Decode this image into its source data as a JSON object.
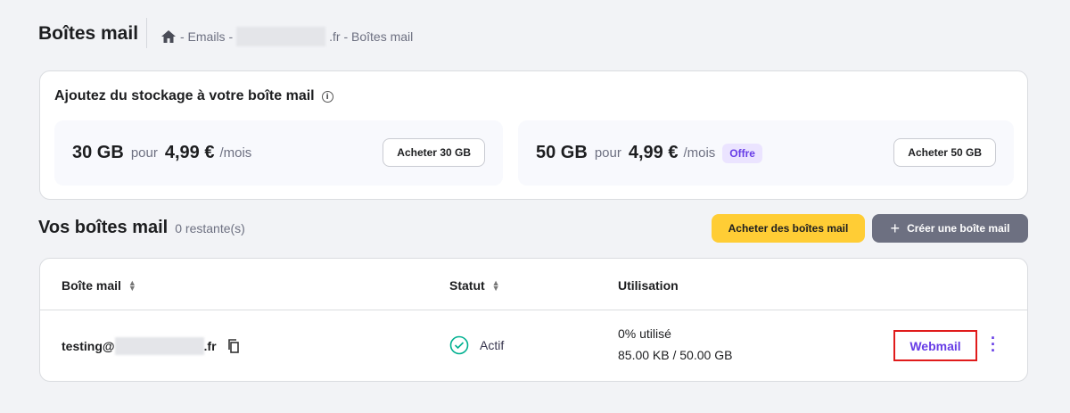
{
  "header": {
    "title": "Boîtes mail",
    "breadcrumb": {
      "emails": "- Emails -",
      "domain_suffix": ".fr - Boîtes mail"
    }
  },
  "storage": {
    "title": "Ajoutez du stockage à votre boîte mail",
    "offers": [
      {
        "size": "30 GB",
        "pour": "pour",
        "price": "4,99 €",
        "period": "/mois",
        "button": "Acheter 30 GB"
      },
      {
        "size": "50 GB",
        "pour": "pour",
        "price": "4,99 €",
        "period": "/mois",
        "badge": "Offre",
        "button": "Acheter 50 GB"
      }
    ]
  },
  "mailboxes": {
    "title": "Vos boîtes mail",
    "remaining": "0 restante(s)",
    "buy_button": "Acheter des boîtes mail",
    "create_button": "Créer une boîte mail",
    "columns": [
      "Boîte mail",
      "Statut",
      "Utilisation"
    ],
    "rows": [
      {
        "email_prefix": "testing@",
        "email_suffix": ".fr",
        "status": "Actif",
        "usage_percent": "0% utilisé",
        "usage": "85.00 KB / 50.00 GB",
        "webmail": "Webmail"
      }
    ]
  },
  "colors": {
    "accent": "#673de6",
    "yellow": "#ffcd35",
    "success": "#00b090"
  }
}
